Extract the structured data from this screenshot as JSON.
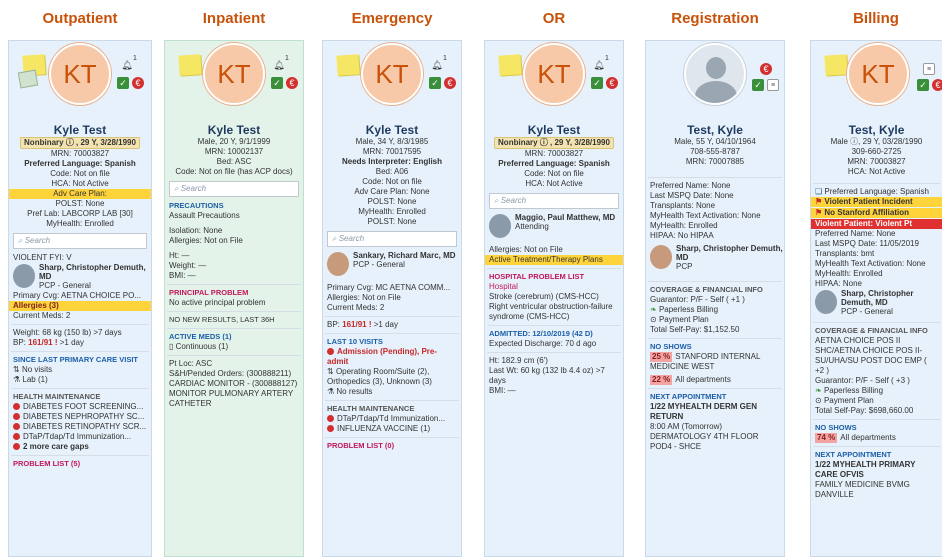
{
  "columns": {
    "outpatient": "Outpatient",
    "inpatient": "Inpatient",
    "emergency": "Emergency",
    "or": "OR",
    "registration": "Registration",
    "billing": "Billing"
  },
  "initials": "KT",
  "bell_count": "1",
  "search_placeholder": "Search",
  "outpatient": {
    "name": "Kyle Test",
    "demo": "Nonbinary ⓘ , 29 Y, 3/28/1990",
    "mrn": "MRN: 70003827",
    "lang": "Preferred Language: Spanish",
    "code": "Code: Not on file",
    "hca": "HCA: Not Active",
    "adv": "Adv Care Plan:",
    "polst": "POLST: None",
    "pref_lab": "Pref Lab: LABCORP LAB [30]",
    "myhealth": "MyHealth: Enrolled",
    "fyi": "VIOLENT FYI: V",
    "pcp_name": "Sharp, Christopher Demuth, MD",
    "pcp_role": "PCP - General",
    "cvg": "Primary Cvg: AETNA CHOICE PO...",
    "allergies": "Allergies (3)",
    "meds": "Current Meds: 2",
    "weight": "Weight: 68 kg (150 lb) >7 days",
    "bp_label": "BP:",
    "bp_value": "161/91 !",
    "bp_age": ">1 day",
    "since": "SINCE LAST PRIMARY CARE VISIT",
    "no_visits": "No visits",
    "lab": "Lab (1)",
    "hm_title": "HEALTH MAINTENANCE",
    "hm": [
      "DIABETES FOOT SCREENING...",
      "DIABETES NEPHROPATHY SC...",
      "DIABETES RETINOPATHY SCR...",
      "DTaP/Tdap/Td Immunization...",
      "2 more care gaps"
    ],
    "problems": "PROBLEM LIST (5)"
  },
  "inpatient": {
    "name": "Kyle Test",
    "demo": "Male, 20 Y, 9/1/1999",
    "mrn": "MRN: 10002137",
    "bed": "Bed: ASC",
    "code": "Code: Not on file (has ACP docs)",
    "precautions_title": "PRECAUTIONS",
    "precautions": "Assault Precautions",
    "isolation": "Isolation: None",
    "allergies": "Allergies: Not on File",
    "ht": "Ht: —",
    "weight": "Weight: —",
    "bmi": "BMI: —",
    "principal_title": "PRINCIPAL PROBLEM",
    "principal": "No active principal problem",
    "no_results": "NO NEW RESULTS, LAST 36H",
    "meds_title": "ACTIVE MEDS (1)",
    "meds": "Continuous (1)",
    "pt_loc": "Pt Loc: ASC",
    "orders": "S&H/Pended Orders: (300888211) CARDIAC MONITOR - (300888127) MONITOR PULMONARY ARTERY CATHETER"
  },
  "emergency": {
    "name": "Kyle Test",
    "demo": "Male, 34 Y, 8/3/1985",
    "mrn": "MRN: 70017595",
    "interp": "Needs Interpreter: English",
    "bed": "Bed: A06",
    "code": "Code: Not on file",
    "adv": "Adv Care Plan: None",
    "polst": "POLST: None",
    "myhealth": "MyHealth: Enrolled",
    "polst2": "POLST: None",
    "pcp_name": "Sankary, Richard Marc, MD",
    "pcp_role": "PCP - General",
    "cvg": "Primary Cvg: MC AETNA COMM...",
    "allergies": "Allergies: Not on File",
    "meds": "Current Meds: 2",
    "bp_label": "BP:",
    "bp_value": "161/91 !",
    "bp_age": ">1 day",
    "visits_title": "LAST 10 VISITS",
    "visit1": "Admission (Pending), Pre-admit",
    "visit2": "Operating Room/Suite (2), Orthopedics (3), Unknown (3)",
    "no_results": "No results",
    "hm_title": "HEALTH MAINTENANCE",
    "hm": [
      "DTaP/Tdap/Td Immunization...",
      "INFLUENZA VACCINE (1)"
    ],
    "problems": "PROBLEM LIST (0)"
  },
  "or": {
    "name": "Kyle Test",
    "demo": "Nonbinary ⓘ , 29 Y, 3/28/1990",
    "mrn": "MRN: 70003827",
    "lang": "Preferred Language: Spanish",
    "code": "Code: Not on file",
    "hca": "HCA: Not Active",
    "attending_name": "Maggio, Paul Matthew, MD",
    "attending_role": "Attending",
    "allergies": "Allergies: Not on File",
    "active_plans": "Active Treatment/Therapy Plans",
    "hpl_title": "HOSPITAL PROBLEM LIST",
    "hospital": "Hospital",
    "problem1": "Stroke (cerebrum) (CMS-HCC)",
    "problem2": "Right ventricular obstruction-failure syndrome (CMS-HCC)",
    "admitted": "ADMITTED: 12/10/2019 (42 D)",
    "discharge": "Expected Discharge: 70 d ago",
    "ht": "Ht: 182.9 cm (6')",
    "wt": "Last Wt: 60 kg (132 lb 4.4 oz) >7 days",
    "bmi": "BMI: —"
  },
  "registration": {
    "name": "Test, Kyle",
    "demo": "Male, 55 Y, 04/10/1964",
    "phone": "708-555-8787",
    "mrn": "MRN: 70007885",
    "pref_name": "Preferred Name: None",
    "mspq": "Last MSPQ Date: None",
    "transplants": "Transplants: None",
    "text_act": "MyHealth Text Activation: None",
    "myhealth": "MyHealth: Enrolled",
    "hipaa": "HIPAA: No HIPAA",
    "pcp_name": "Sharp, Christopher Demuth, MD",
    "pcp_role": "PCP",
    "cov_title": "COVERAGE & FINANCIAL INFO",
    "guarantor": "Guarantor: P/F - Self ( +1 )",
    "paperless": "Paperless Billing",
    "payment": "Payment Plan",
    "selfpay": "Total Self-Pay: $1,152.50",
    "noshow_title": "NO SHOWS",
    "ns1_pct": "25 %",
    "ns1": "STANFORD INTERNAL MEDICINE WEST",
    "ns2_pct": "22 %",
    "ns2": "All departments",
    "next_title": "NEXT APPOINTMENT",
    "next1": "1/22 MYHEALTH DERM GEN RETURN",
    "next2": "8:00 AM (Tomorrow)",
    "next3": "DERMATOLOGY 4TH FLOOR POD4 - SHCE"
  },
  "billing": {
    "name": "Test, Kyle",
    "demo": "Male ⓘ, 29 Y, 03/28/1990",
    "phone": "309-660-2725",
    "mrn": "MRN: 70003827",
    "hca": "HCA: Not Active",
    "lang": "Preferred Language: Spanish",
    "flag1": "Violent Patient Incident",
    "flag2": "No Stanford Affiliation",
    "flag3": "Violent Patient: Violent Pt",
    "pref_name": "Preferred Name: None",
    "mspq": "Last MSPQ Date: 11/05/2019",
    "transplants": "Transplants: bmt",
    "text_act": "MyHealth Text Activation: None",
    "myhealth": "MyHealth: Enrolled",
    "hipaa": "HIPAA: None",
    "pcp_name": "Sharp, Christopher Demuth, MD",
    "pcp_role": "PCP - General",
    "cov_title": "COVERAGE & FINANCIAL INFO",
    "cov1": "AETNA CHOICE POS II",
    "cov2": "SHC/AETNA CHOICE POS II-SU/UHA/SU POST DOC EMP ( +2 )",
    "guarantor": "Guarantor: P/F - Self ( +3 )",
    "paperless": "Paperless Billing",
    "payment": "Payment Plan",
    "selfpay": "Total Self-Pay: $698,660.00",
    "noshow_title": "NO SHOWS",
    "ns_pct": "74 %",
    "ns": "All departments",
    "next_title": "NEXT APPOINTMENT",
    "next1": "1/22 MYHEALTH PRIMARY CARE OFVIS",
    "next2": "FAMILY MEDICINE BVMG DANVILLE"
  }
}
